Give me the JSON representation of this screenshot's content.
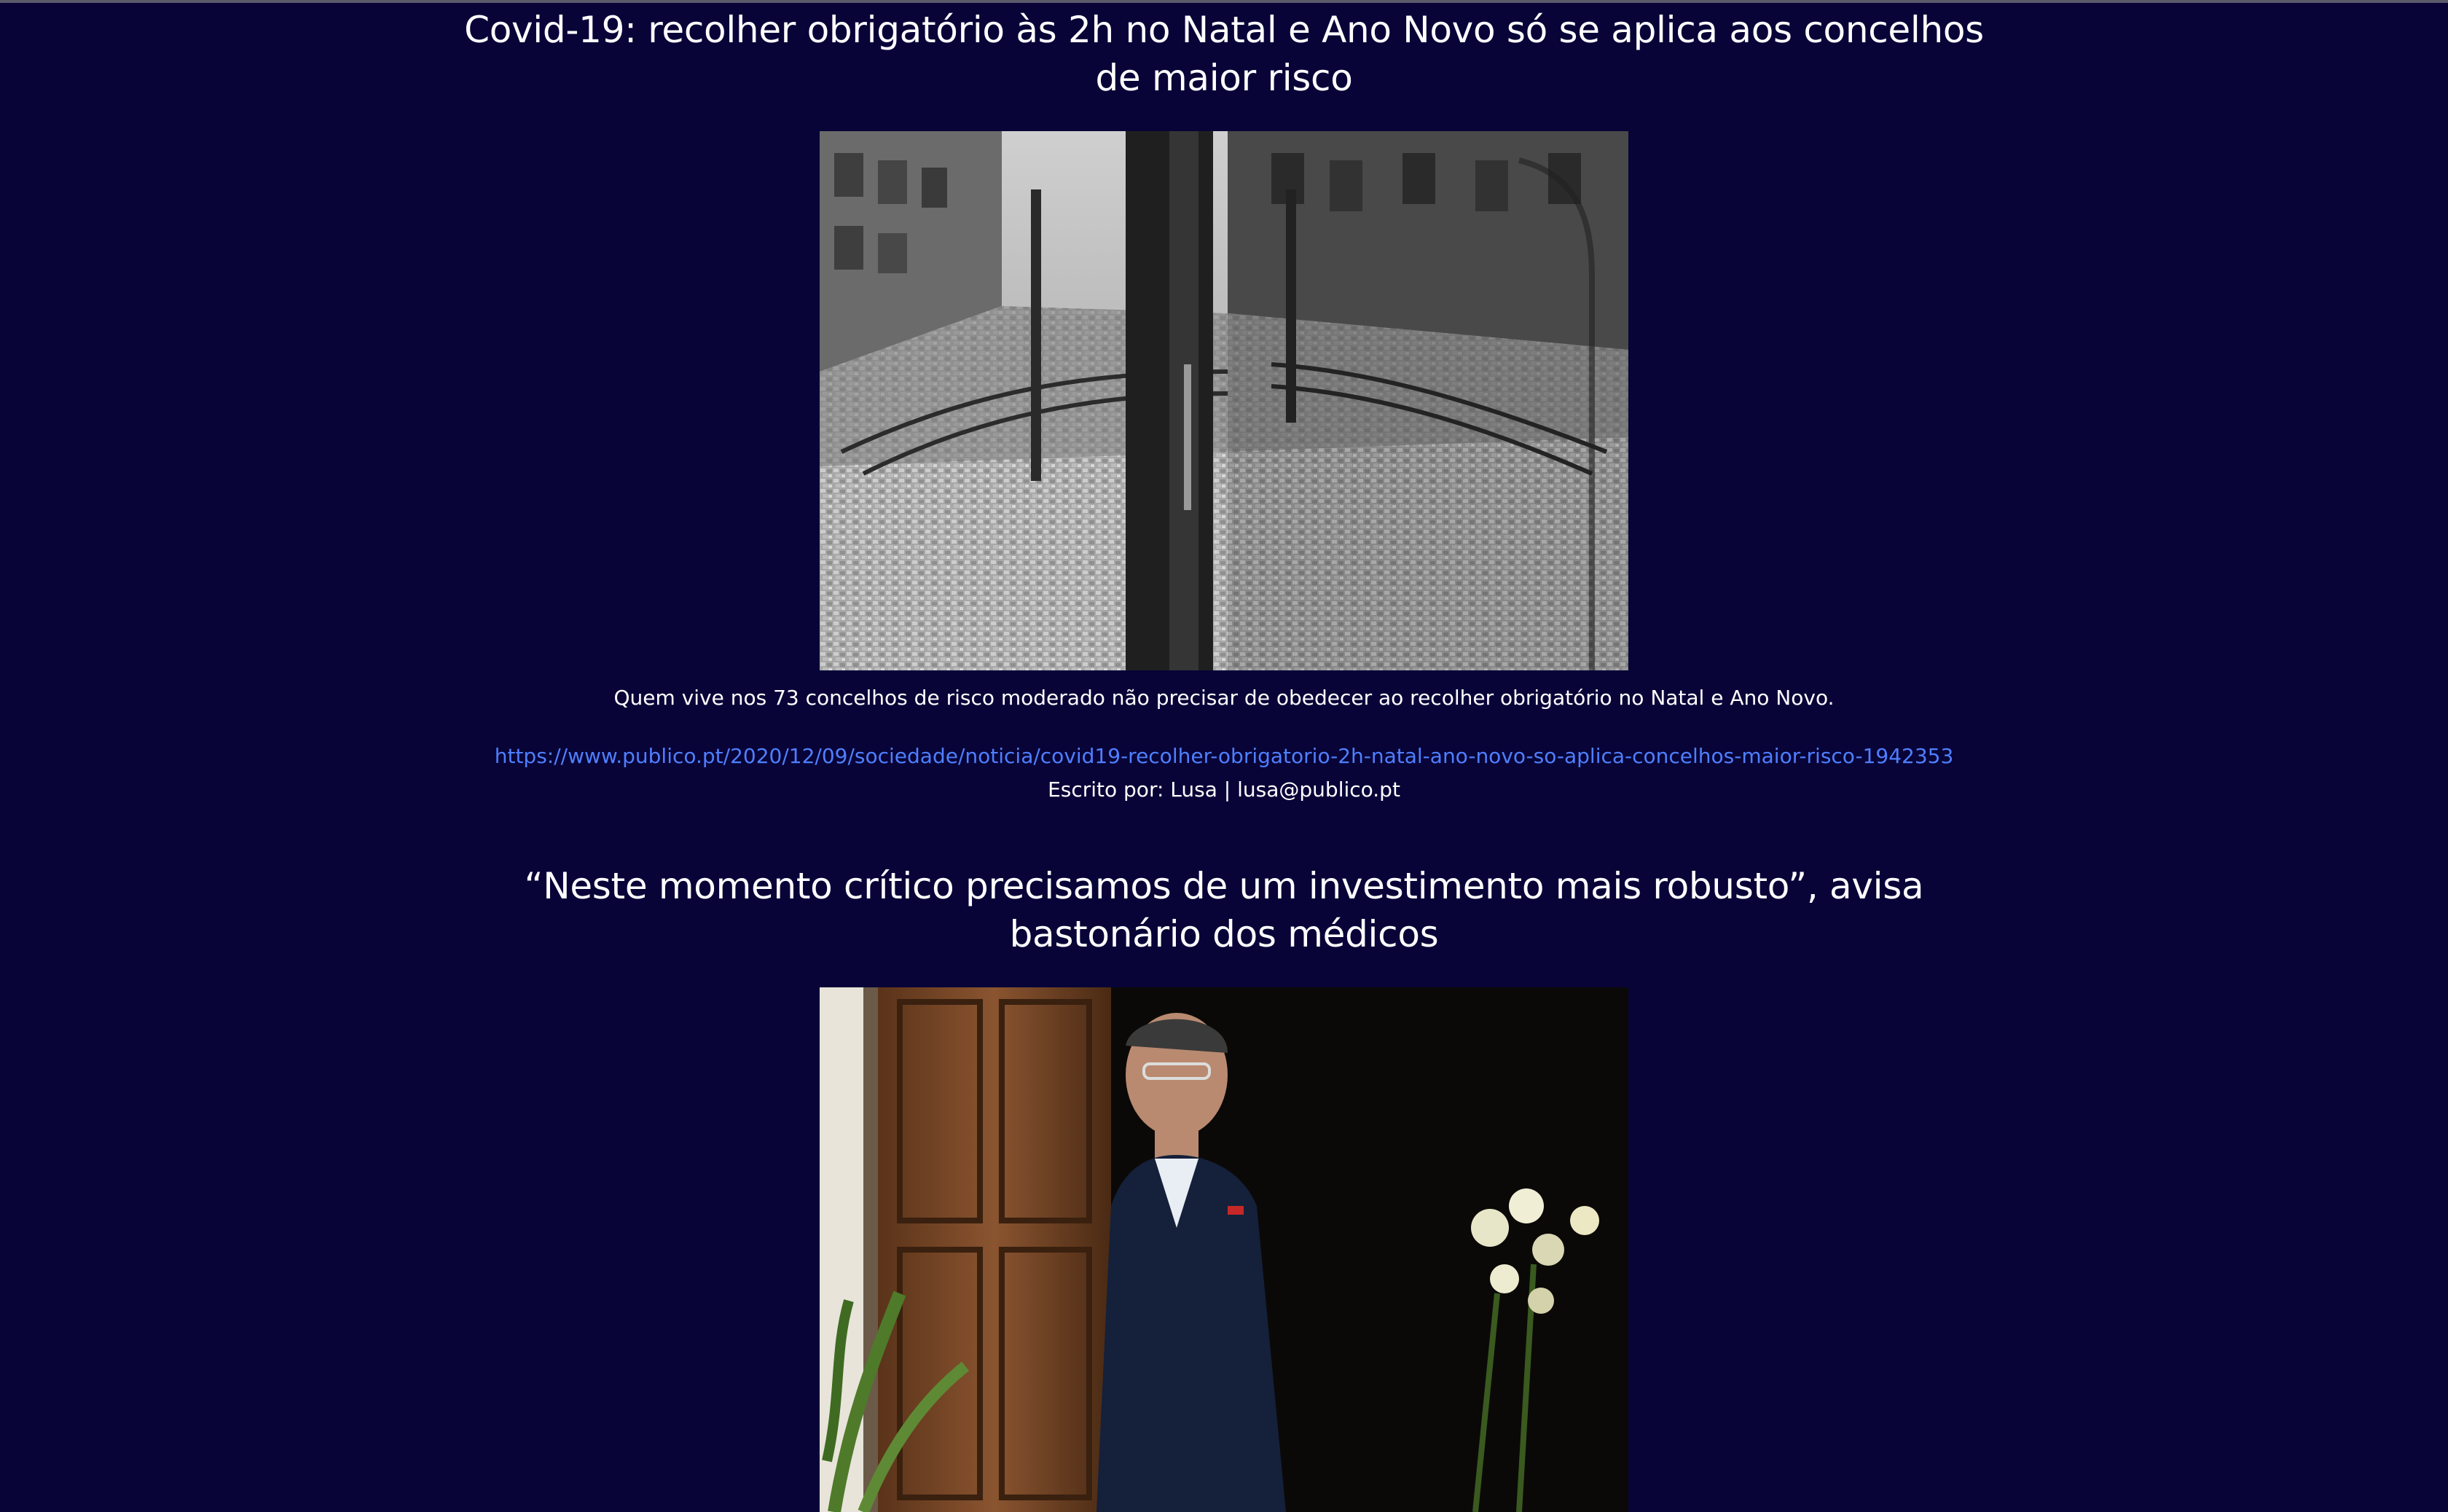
{
  "articles": [
    {
      "headline": "Covid-19: recolher obrigatório às 2h no Natal e Ano Novo só se aplica aos concelhos de maior risco",
      "caption": "Quem vive nos 73 concelhos de risco moderado não precisar de obedecer ao recolher obrigatório no Natal e Ano Novo.",
      "link": "https://www.publico.pt/2020/12/09/sociedade/noticia/covid19-recolher-obrigatorio-2h-natal-ano-novo-so-aplica-concelhos-maior-risco-1942353",
      "byline": "Escrito por: Lusa | lusa@publico.pt",
      "image_desc": "street-reflection-photo"
    },
    {
      "headline": "“Neste momento crítico precisamos de um investimento mais robusto”, avisa bastonário dos médicos",
      "image_desc": "portrait-photo"
    }
  ],
  "colors": {
    "background": "#080438",
    "link": "#4f7fff",
    "text": "#ffffff"
  }
}
